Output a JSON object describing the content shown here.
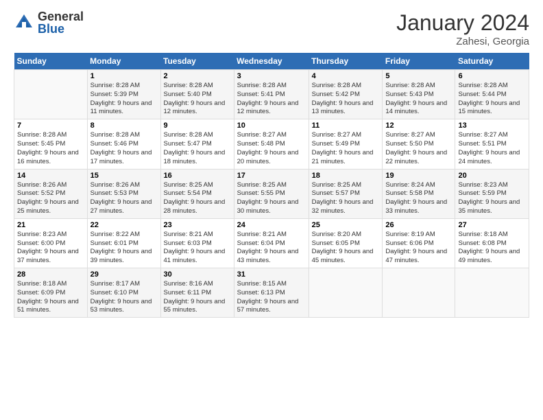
{
  "header": {
    "logo_general": "General",
    "logo_blue": "Blue",
    "month_title": "January 2024",
    "location": "Zahesi, Georgia"
  },
  "days_of_week": [
    "Sunday",
    "Monday",
    "Tuesday",
    "Wednesday",
    "Thursday",
    "Friday",
    "Saturday"
  ],
  "weeks": [
    [
      {
        "day": "",
        "sunrise": "",
        "sunset": "",
        "daylight": ""
      },
      {
        "day": "1",
        "sunrise": "Sunrise: 8:28 AM",
        "sunset": "Sunset: 5:39 PM",
        "daylight": "Daylight: 9 hours and 11 minutes."
      },
      {
        "day": "2",
        "sunrise": "Sunrise: 8:28 AM",
        "sunset": "Sunset: 5:40 PM",
        "daylight": "Daylight: 9 hours and 12 minutes."
      },
      {
        "day": "3",
        "sunrise": "Sunrise: 8:28 AM",
        "sunset": "Sunset: 5:41 PM",
        "daylight": "Daylight: 9 hours and 12 minutes."
      },
      {
        "day": "4",
        "sunrise": "Sunrise: 8:28 AM",
        "sunset": "Sunset: 5:42 PM",
        "daylight": "Daylight: 9 hours and 13 minutes."
      },
      {
        "day": "5",
        "sunrise": "Sunrise: 8:28 AM",
        "sunset": "Sunset: 5:43 PM",
        "daylight": "Daylight: 9 hours and 14 minutes."
      },
      {
        "day": "6",
        "sunrise": "Sunrise: 8:28 AM",
        "sunset": "Sunset: 5:44 PM",
        "daylight": "Daylight: 9 hours and 15 minutes."
      }
    ],
    [
      {
        "day": "7",
        "sunrise": "Sunrise: 8:28 AM",
        "sunset": "Sunset: 5:45 PM",
        "daylight": "Daylight: 9 hours and 16 minutes."
      },
      {
        "day": "8",
        "sunrise": "Sunrise: 8:28 AM",
        "sunset": "Sunset: 5:46 PM",
        "daylight": "Daylight: 9 hours and 17 minutes."
      },
      {
        "day": "9",
        "sunrise": "Sunrise: 8:28 AM",
        "sunset": "Sunset: 5:47 PM",
        "daylight": "Daylight: 9 hours and 18 minutes."
      },
      {
        "day": "10",
        "sunrise": "Sunrise: 8:27 AM",
        "sunset": "Sunset: 5:48 PM",
        "daylight": "Daylight: 9 hours and 20 minutes."
      },
      {
        "day": "11",
        "sunrise": "Sunrise: 8:27 AM",
        "sunset": "Sunset: 5:49 PM",
        "daylight": "Daylight: 9 hours and 21 minutes."
      },
      {
        "day": "12",
        "sunrise": "Sunrise: 8:27 AM",
        "sunset": "Sunset: 5:50 PM",
        "daylight": "Daylight: 9 hours and 22 minutes."
      },
      {
        "day": "13",
        "sunrise": "Sunrise: 8:27 AM",
        "sunset": "Sunset: 5:51 PM",
        "daylight": "Daylight: 9 hours and 24 minutes."
      }
    ],
    [
      {
        "day": "14",
        "sunrise": "Sunrise: 8:26 AM",
        "sunset": "Sunset: 5:52 PM",
        "daylight": "Daylight: 9 hours and 25 minutes."
      },
      {
        "day": "15",
        "sunrise": "Sunrise: 8:26 AM",
        "sunset": "Sunset: 5:53 PM",
        "daylight": "Daylight: 9 hours and 27 minutes."
      },
      {
        "day": "16",
        "sunrise": "Sunrise: 8:25 AM",
        "sunset": "Sunset: 5:54 PM",
        "daylight": "Daylight: 9 hours and 28 minutes."
      },
      {
        "day": "17",
        "sunrise": "Sunrise: 8:25 AM",
        "sunset": "Sunset: 5:55 PM",
        "daylight": "Daylight: 9 hours and 30 minutes."
      },
      {
        "day": "18",
        "sunrise": "Sunrise: 8:25 AM",
        "sunset": "Sunset: 5:57 PM",
        "daylight": "Daylight: 9 hours and 32 minutes."
      },
      {
        "day": "19",
        "sunrise": "Sunrise: 8:24 AM",
        "sunset": "Sunset: 5:58 PM",
        "daylight": "Daylight: 9 hours and 33 minutes."
      },
      {
        "day": "20",
        "sunrise": "Sunrise: 8:23 AM",
        "sunset": "Sunset: 5:59 PM",
        "daylight": "Daylight: 9 hours and 35 minutes."
      }
    ],
    [
      {
        "day": "21",
        "sunrise": "Sunrise: 8:23 AM",
        "sunset": "Sunset: 6:00 PM",
        "daylight": "Daylight: 9 hours and 37 minutes."
      },
      {
        "day": "22",
        "sunrise": "Sunrise: 8:22 AM",
        "sunset": "Sunset: 6:01 PM",
        "daylight": "Daylight: 9 hours and 39 minutes."
      },
      {
        "day": "23",
        "sunrise": "Sunrise: 8:21 AM",
        "sunset": "Sunset: 6:03 PM",
        "daylight": "Daylight: 9 hours and 41 minutes."
      },
      {
        "day": "24",
        "sunrise": "Sunrise: 8:21 AM",
        "sunset": "Sunset: 6:04 PM",
        "daylight": "Daylight: 9 hours and 43 minutes."
      },
      {
        "day": "25",
        "sunrise": "Sunrise: 8:20 AM",
        "sunset": "Sunset: 6:05 PM",
        "daylight": "Daylight: 9 hours and 45 minutes."
      },
      {
        "day": "26",
        "sunrise": "Sunrise: 8:19 AM",
        "sunset": "Sunset: 6:06 PM",
        "daylight": "Daylight: 9 hours and 47 minutes."
      },
      {
        "day": "27",
        "sunrise": "Sunrise: 8:18 AM",
        "sunset": "Sunset: 6:08 PM",
        "daylight": "Daylight: 9 hours and 49 minutes."
      }
    ],
    [
      {
        "day": "28",
        "sunrise": "Sunrise: 8:18 AM",
        "sunset": "Sunset: 6:09 PM",
        "daylight": "Daylight: 9 hours and 51 minutes."
      },
      {
        "day": "29",
        "sunrise": "Sunrise: 8:17 AM",
        "sunset": "Sunset: 6:10 PM",
        "daylight": "Daylight: 9 hours and 53 minutes."
      },
      {
        "day": "30",
        "sunrise": "Sunrise: 8:16 AM",
        "sunset": "Sunset: 6:11 PM",
        "daylight": "Daylight: 9 hours and 55 minutes."
      },
      {
        "day": "31",
        "sunrise": "Sunrise: 8:15 AM",
        "sunset": "Sunset: 6:13 PM",
        "daylight": "Daylight: 9 hours and 57 minutes."
      },
      {
        "day": "",
        "sunrise": "",
        "sunset": "",
        "daylight": ""
      },
      {
        "day": "",
        "sunrise": "",
        "sunset": "",
        "daylight": ""
      },
      {
        "day": "",
        "sunrise": "",
        "sunset": "",
        "daylight": ""
      }
    ]
  ]
}
